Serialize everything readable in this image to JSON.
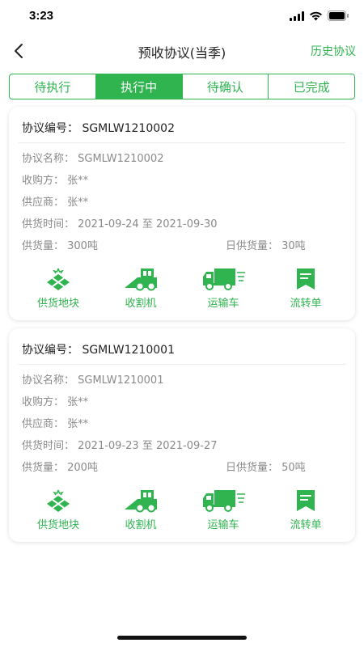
{
  "status": {
    "time": "3:23"
  },
  "nav": {
    "title": "预收协议(当季)",
    "right_link": "历史协议"
  },
  "tabs": [
    {
      "label": "待执行",
      "active": false
    },
    {
      "label": "执行中",
      "active": true
    },
    {
      "label": "待确认",
      "active": false
    },
    {
      "label": "已完成",
      "active": false
    }
  ],
  "cards": [
    {
      "header": "协议编号：  SGMLW1210002",
      "name": "协议名称：  SGMLW1210002",
      "buyer": "收购方：  张**",
      "supplier": "供应商：  张**",
      "supply_time": "供货时间：  2021-09-24  至  2021-09-30",
      "supply_amount": "供货量：  300吨",
      "daily_amount": "日供货量：  30吨"
    },
    {
      "header": "协议编号：  SGMLW1210001",
      "name": "协议名称：  SGMLW1210001",
      "buyer": "收购方：  张**",
      "supplier": "供应商：  张**",
      "supply_time": "供货时间：  2021-09-23  至  2021-09-27",
      "supply_amount": "供货量：  200吨",
      "daily_amount": "日供货量：  50吨"
    }
  ],
  "actions": {
    "plot": "供货地块",
    "harvester": "收割机",
    "truck": "运输车",
    "waybill": "流转单"
  },
  "colors": {
    "accent": "#2fb450"
  }
}
